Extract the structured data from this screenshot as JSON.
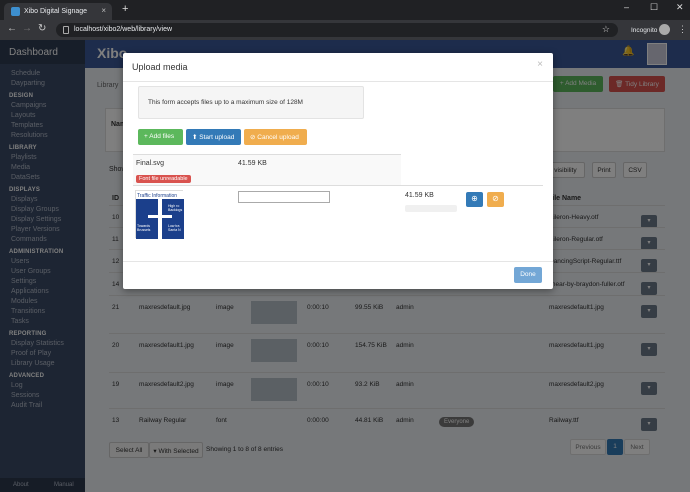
{
  "browser": {
    "tab_title": "Xibo Digital Signage",
    "tab_close": "×",
    "new_tab": "+",
    "url": "localhost/xibo2/web/library/view",
    "incognito": "Incognito",
    "min": "–",
    "max": "☐",
    "close": "✕"
  },
  "sidebar": {
    "title": "Dashboard",
    "sections": [
      {
        "label": "",
        "items": [
          "Schedule",
          "Dayparting"
        ]
      },
      {
        "label": "DESIGN",
        "items": [
          "Campaigns",
          "Layouts",
          "Templates",
          "Resolutions"
        ]
      },
      {
        "label": "LIBRARY",
        "items": [
          "Playlists",
          "Media",
          "DataSets"
        ]
      },
      {
        "label": "DISPLAYS",
        "items": [
          "Displays",
          "Display Groups",
          "Display Settings",
          "Player Versions",
          "Commands"
        ]
      },
      {
        "label": "ADMINISTRATION",
        "items": [
          "Users",
          "User Groups",
          "Settings",
          "Applications",
          "Modules",
          "Transitions",
          "Tasks"
        ]
      },
      {
        "label": "REPORTING",
        "items": [
          "Display Statistics",
          "Proof of Play",
          "Library Usage"
        ]
      },
      {
        "label": "ADVANCED",
        "items": [
          "Log",
          "Sessions",
          "Audit Trail"
        ]
      }
    ],
    "footer_about": "About",
    "footer_manual": "Manual"
  },
  "page": {
    "brand": "Xibo",
    "crumb": "Library",
    "add_media": "+ Add Media",
    "tidy_library": "🗑 Tidy Library",
    "filter_label": "Nam",
    "show_label": "Show",
    "column_visibility": "mn visibility",
    "print": "Print",
    "csv": "CSV",
    "col_id": "ID",
    "col_file": "File Name",
    "rows": [
      {
        "id": "10",
        "name": "",
        "type": "",
        "dur": "",
        "size": "",
        "owner": "",
        "file": "Aileron-Heavy.otf"
      },
      {
        "id": "11",
        "name": "",
        "type": "",
        "dur": "",
        "size": "",
        "owner": "",
        "file": "Aileron-Regular.otf"
      },
      {
        "id": "12",
        "name": "",
        "type": "",
        "dur": "",
        "size": "",
        "owner": "",
        "file": "DancingScript-Regular.ttf"
      },
      {
        "id": "14",
        "name": "",
        "type": "",
        "dur": "",
        "size": "",
        "owner": "",
        "file": "linear-by-braydon-fuller.otf"
      },
      {
        "id": "21",
        "name": "maxresdefault.jpg",
        "type": "image",
        "dur": "0:00:10",
        "size": "99.55 KiB",
        "owner": "admin",
        "file": "maxresdefault1.jpg"
      },
      {
        "id": "20",
        "name": "maxresdefault1.jpg",
        "type": "image",
        "dur": "0:00:10",
        "size": "154.75 KiB",
        "owner": "admin",
        "file": "maxresdefault1.jpg"
      },
      {
        "id": "19",
        "name": "maxresdefault2.jpg",
        "type": "image",
        "dur": "0:00:10",
        "size": "93.2 KiB",
        "owner": "admin",
        "file": "maxresdefault2.jpg"
      },
      {
        "id": "13",
        "name": "Railway Regular",
        "type": "font",
        "dur": "0:00:00",
        "size": "44.81 KiB",
        "owner": "admin",
        "file": "Railway.ttf"
      }
    ],
    "everyone_badge": "Everyone",
    "select_all": "Select All",
    "with_selected": "▾ With Selected",
    "entries": "Showing 1 to 8 of 8 entries",
    "previous": "Previous",
    "page_num": "1",
    "next": "Next"
  },
  "modal": {
    "title": "Upload media",
    "close": "×",
    "info": "This form accepts files up to a maximum size of 128M",
    "add_files": "+ Add files",
    "start_upload": "⬆ Start upload",
    "cancel_upload": "⊘ Cancel upload",
    "file1_name": "Final.svg",
    "file1_size": "41.59 KB",
    "file1_error": "Font file unreadable",
    "preview_label": "Traffic Information",
    "preview_high": "High ro",
    "preview_back": "Backlogs",
    "preview_towards": "Towards",
    "preview_brussels": "Brussels",
    "preview_low": "Low tra",
    "preview_santa": "Santa N",
    "file2_size": "41.59 KB",
    "upload_glyph": "⊕",
    "cancel_glyph": "⊘",
    "done": "Done"
  },
  "colors": {
    "primary": "#337ab7",
    "success": "#5cb85c",
    "warning": "#f0ad4e",
    "danger": "#d9534f",
    "sidebar": "#3b4b66"
  }
}
